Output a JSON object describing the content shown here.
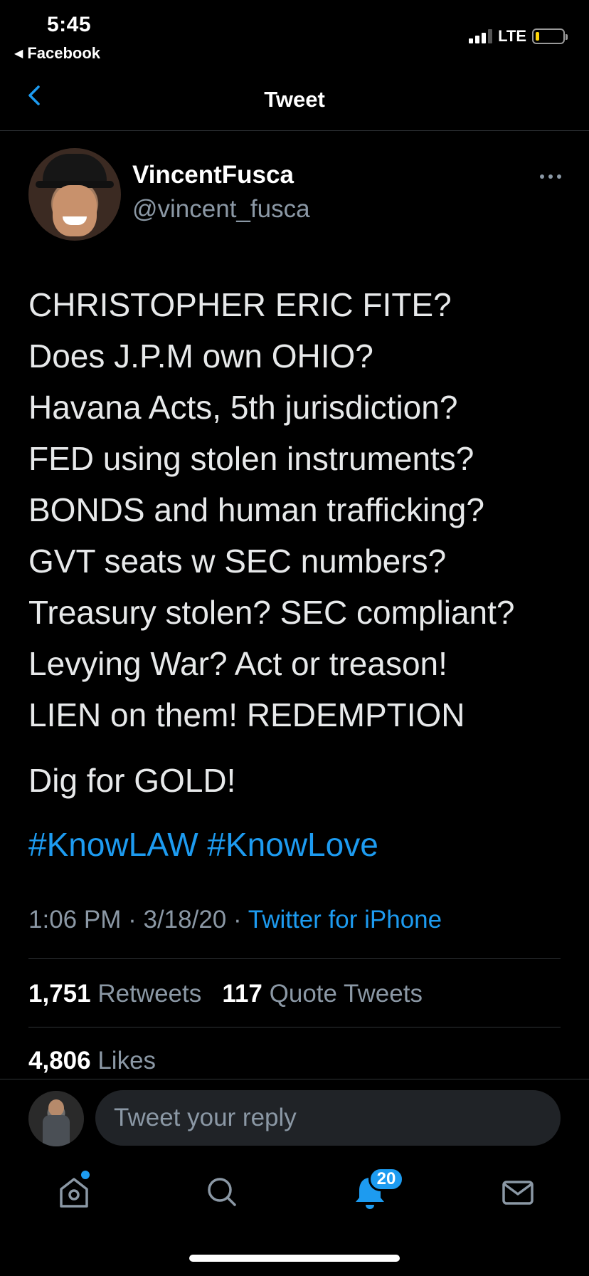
{
  "status_bar": {
    "time": "5:45",
    "back_app": "Facebook",
    "network": "LTE",
    "signal_bars_on": 3,
    "battery_level": 0.15,
    "battery_color": "#ffd60a"
  },
  "nav": {
    "title": "Tweet"
  },
  "tweet": {
    "display_name": "VincentFusca",
    "handle": "@vincent_fusca",
    "lines": [
      "CHRISTOPHER ERIC FITE?",
      "Does J.P.M own OHIO?",
      "Havana Acts, 5th jurisdiction?",
      "FED using stolen instruments?",
      "BONDS and human trafficking?",
      "GVT seats w SEC numbers?",
      "Treasury stolen? SEC compliant?",
      "Levying War? Act or treason!",
      "LIEN on them! REDEMPTION"
    ],
    "extra_line": "Dig for GOLD!",
    "hashtags": [
      "#KnowLAW",
      "#KnowLove"
    ],
    "time": "1:06 PM",
    "date": "3/18/20",
    "separator": "·",
    "source": "Twitter for iPhone",
    "retweets_count": "1,751",
    "retweets_label": "Retweets",
    "quotes_count": "117",
    "quotes_label": "Quote Tweets",
    "likes_count": "4,806",
    "likes_label": "Likes"
  },
  "reply": {
    "placeholder": "Tweet your reply"
  },
  "tab_bar": {
    "items": [
      "home-icon",
      "search-icon",
      "notifications-icon",
      "messages-icon"
    ],
    "notifications_badge": "20",
    "accent_color": "#1d9bf0"
  }
}
